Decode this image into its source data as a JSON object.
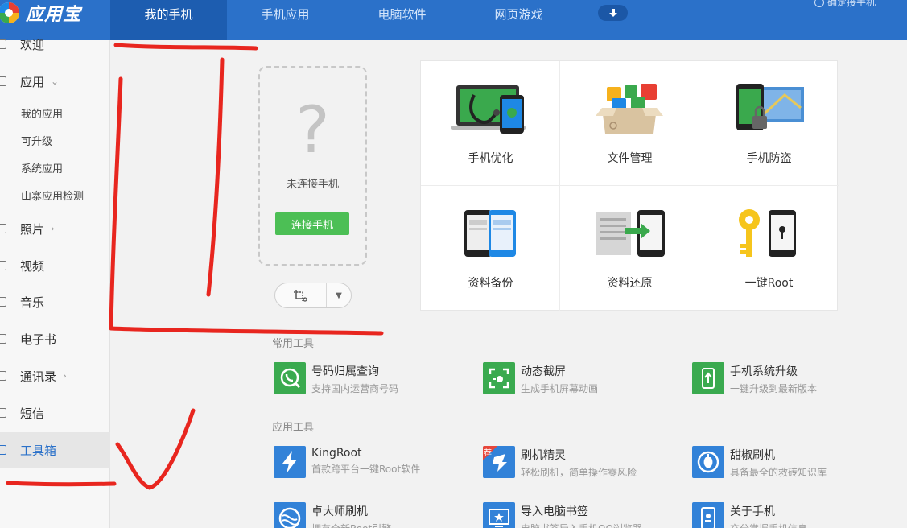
{
  "app": {
    "title": "应用宝"
  },
  "colors": {
    "brand": "#2b71c9",
    "accent_green": "#4cbf55",
    "annotation_red": "#e8261f"
  },
  "nav": {
    "tabs": [
      {
        "label": "我的手机",
        "active": true
      },
      {
        "label": "手机应用",
        "active": false
      },
      {
        "label": "电脑软件",
        "active": false
      },
      {
        "label": "网页游戏",
        "active": false
      }
    ],
    "connect_label": "确定接手机"
  },
  "sidebar": {
    "items": [
      {
        "label": "欢迎"
      },
      {
        "label": "应用"
      },
      {
        "label": "照片"
      },
      {
        "label": "视频"
      },
      {
        "label": "音乐"
      },
      {
        "label": "电子书"
      },
      {
        "label": "通讯录"
      },
      {
        "label": "短信"
      },
      {
        "label": "工具箱",
        "active": true
      }
    ],
    "app_subitems": [
      "我的应用",
      "可升级",
      "系统应用",
      "山寨应用检测"
    ]
  },
  "phone": {
    "status": "未连接手机",
    "connect_button": "连接手机",
    "question_mark": "?"
  },
  "features": [
    {
      "label": "手机优化",
      "icon": "phone-optimize-icon"
    },
    {
      "label": "文件管理",
      "icon": "file-manage-icon"
    },
    {
      "label": "手机防盗",
      "icon": "anti-theft-icon"
    },
    {
      "label": "资料备份",
      "icon": "backup-icon"
    },
    {
      "label": "资料还原",
      "icon": "restore-icon"
    },
    {
      "label": "一键Root",
      "icon": "root-key-icon"
    }
  ],
  "common_tools": {
    "title": "常用工具",
    "items": [
      {
        "name": "号码归属查询",
        "desc": "支持国内运营商号码",
        "icon": "phone-search-icon"
      },
      {
        "name": "动态截屏",
        "desc": "生成手机屏幕动画",
        "icon": "screen-capture-icon"
      },
      {
        "name": "手机系统升级",
        "desc": "一键升级到最新版本",
        "icon": "system-upgrade-icon"
      }
    ]
  },
  "app_tools": {
    "title": "应用工具",
    "items": [
      {
        "name": "KingRoot",
        "desc": "首款跨平台一键Root软件",
        "icon": "lightning-icon"
      },
      {
        "name": "刷机精灵",
        "desc": "轻松刷机，简单操作零风险",
        "icon": "flash-spirit-icon",
        "badge": "荐"
      },
      {
        "name": "甜椒刷机",
        "desc": "具备最全的救砖知识库",
        "icon": "pepper-flash-icon"
      },
      {
        "name": "卓大师刷机",
        "desc": "拥有全新Root引擎",
        "icon": "master-flash-icon"
      },
      {
        "name": "导入电脑书签",
        "desc": "电脑书签导入手机QQ浏览器",
        "icon": "bookmark-import-icon"
      },
      {
        "name": "关于手机",
        "desc": "充分掌握手机信息",
        "icon": "phone-info-icon"
      }
    ]
  }
}
